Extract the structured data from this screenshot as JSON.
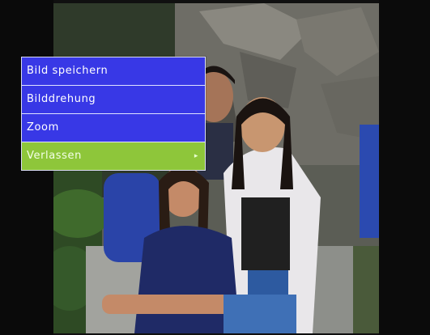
{
  "menu": {
    "items": [
      {
        "label": "Bild speichern",
        "selected": false
      },
      {
        "label": "Bilddrehung",
        "selected": false
      },
      {
        "label": "Zoom",
        "selected": false
      },
      {
        "label": "Verlassen",
        "selected": true
      }
    ],
    "submenu_icon": "chevron-right-icon"
  },
  "colors": {
    "menu_background": "#3838e6",
    "menu_selected": "#8ec63a",
    "menu_text": "#ffffff"
  }
}
